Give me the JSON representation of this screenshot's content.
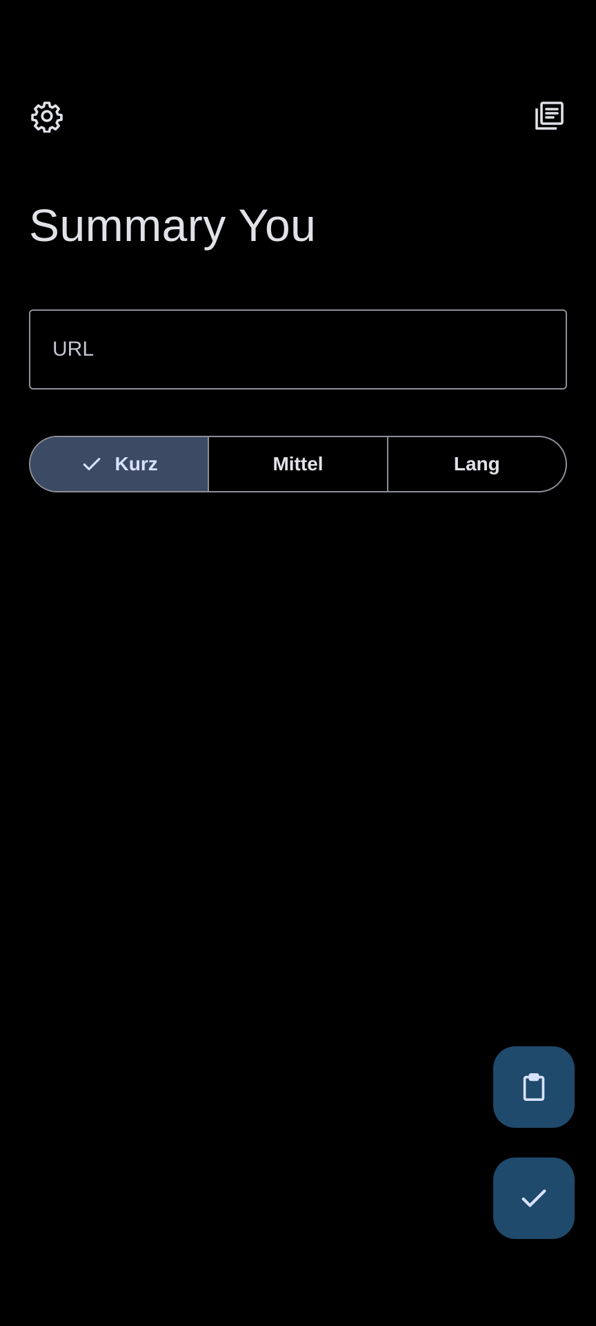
{
  "header": {
    "settings_icon": "gear-icon",
    "history_icon": "article-list-icon"
  },
  "title": "Summary You",
  "url_input": {
    "placeholder": "URL",
    "value": ""
  },
  "length_selector": {
    "options": [
      {
        "label": "Kurz",
        "selected": true
      },
      {
        "label": "Mittel",
        "selected": false
      },
      {
        "label": "Lang",
        "selected": false
      }
    ]
  },
  "fabs": {
    "paste_icon": "clipboard-icon",
    "submit_icon": "check-icon"
  },
  "colors": {
    "background": "#000000",
    "text": "#e1e2e8",
    "outline": "#8e9099",
    "segment_selected": "#3c4a63",
    "fab": "#1f4a6b"
  }
}
